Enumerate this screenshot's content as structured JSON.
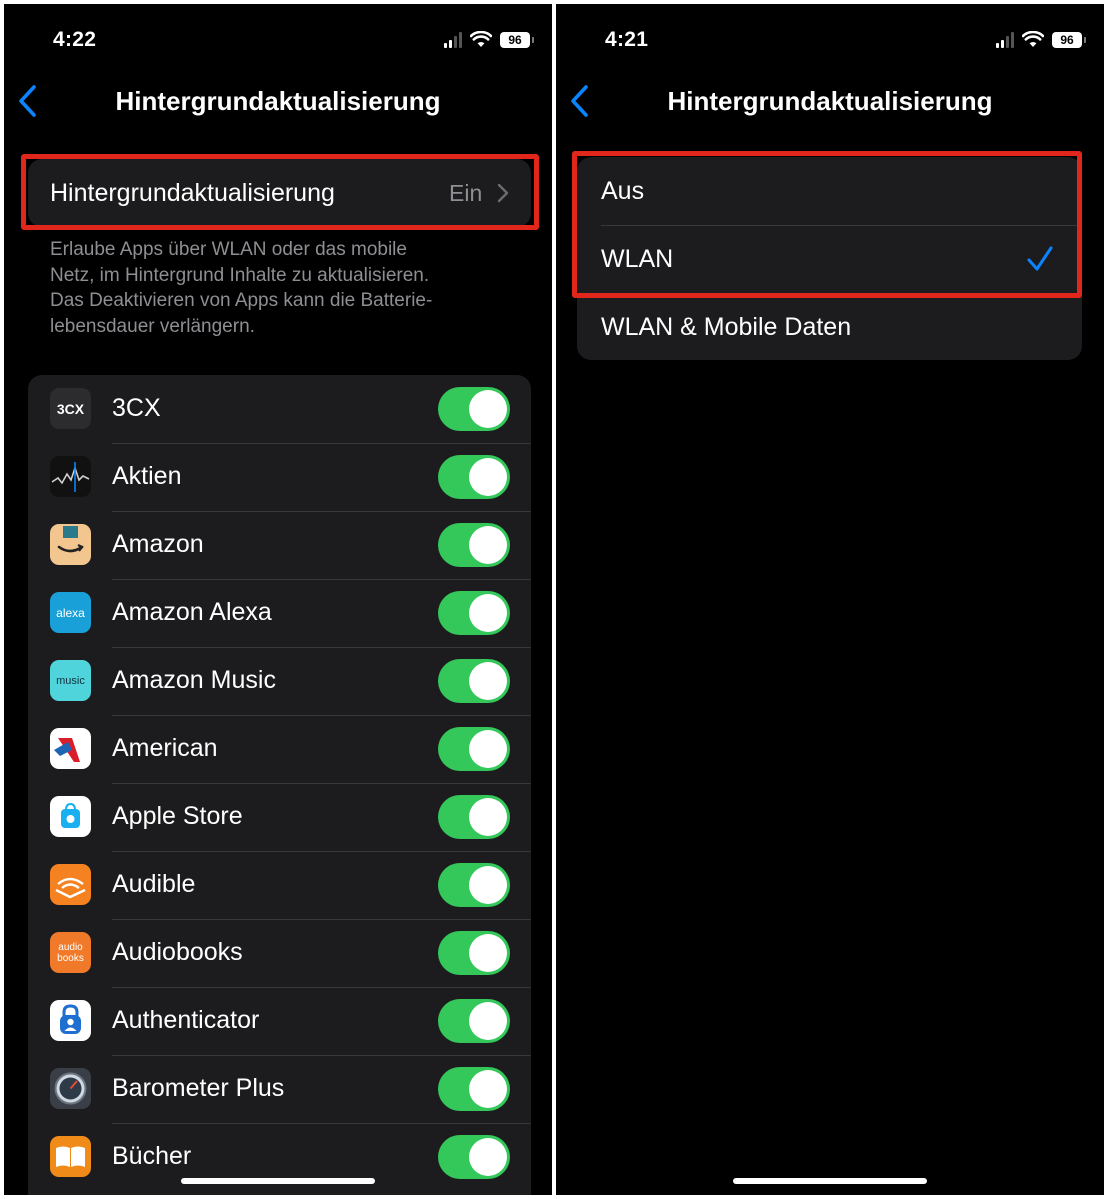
{
  "left": {
    "status": {
      "time": "4:22",
      "battery": "96"
    },
    "title": "Hintergrundaktualisierung",
    "setting": {
      "label": "Hintergrundaktualisierung",
      "value": "Ein"
    },
    "footer": [
      "Erlaube Apps über WLAN oder das mobile",
      "Netz, im Hintergrund Inhalte zu aktualisieren.",
      "Das Deaktivieren von Apps kann die Batterie-",
      "lebensdauer verlängern."
    ],
    "apps": [
      {
        "name": "3CX",
        "icon": "3cx-icon",
        "on": true
      },
      {
        "name": "Aktien",
        "icon": "stocks-icon",
        "on": true
      },
      {
        "name": "Amazon",
        "icon": "amazon-icon",
        "on": true
      },
      {
        "name": "Amazon Alexa",
        "icon": "alexa-icon",
        "on": true
      },
      {
        "name": "Amazon Music",
        "icon": "amazon-music-icon",
        "on": true
      },
      {
        "name": "American",
        "icon": "american-airlines-icon",
        "on": true
      },
      {
        "name": "Apple Store",
        "icon": "apple-store-icon",
        "on": true
      },
      {
        "name": "Audible",
        "icon": "audible-icon",
        "on": true
      },
      {
        "name": "Audiobooks",
        "icon": "audiobooks-icon",
        "on": true
      },
      {
        "name": "Authenticator",
        "icon": "authenticator-icon",
        "on": true
      },
      {
        "name": "Barometer Plus",
        "icon": "barometer-icon",
        "on": true
      },
      {
        "name": "Bücher",
        "icon": "books-icon",
        "on": true
      }
    ],
    "icon_text": {
      "cx": "3CX",
      "alexa": "alexa",
      "music": "music",
      "audio1": "audio",
      "audio2": "books"
    }
  },
  "right": {
    "status": {
      "time": "4:21",
      "battery": "96"
    },
    "title": "Hintergrundaktualisierung",
    "options": [
      {
        "label": "Aus",
        "selected": false
      },
      {
        "label": "WLAN",
        "selected": true
      },
      {
        "label": "WLAN & Mobile Daten",
        "selected": false
      }
    ]
  },
  "colors": {
    "accent": "#0a84ff",
    "toggle_on": "#34c759",
    "highlight": "#e1271c",
    "cell": "#1c1c1e"
  }
}
